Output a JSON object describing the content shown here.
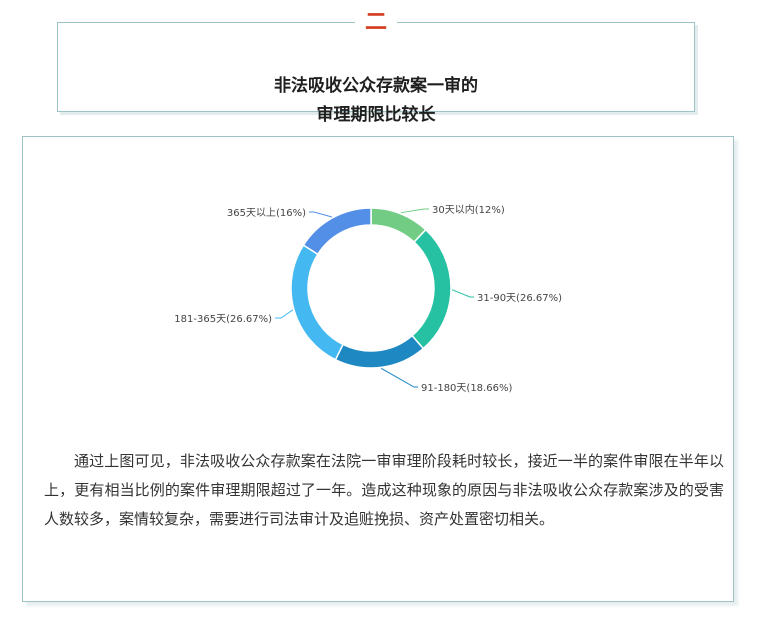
{
  "section": {
    "number": "二",
    "title_line1": "非法吸收公众存款案一审的",
    "title_line2": "审理期限比较长"
  },
  "chart_data": {
    "type": "pie",
    "donut": true,
    "categories": [
      "30天以内",
      "31-90天",
      "91-180天",
      "181-365天",
      "365天以上"
    ],
    "values": [
      12,
      26.67,
      18.66,
      26.67,
      16
    ],
    "labels": [
      "30天以内(12%)",
      "31-90天(26.67%)",
      "91-180天(18.66%)",
      "181-365天(26.67%)",
      "365天以上(16%)"
    ],
    "colors": [
      "#72cc83",
      "#25c1a2",
      "#1e88c3",
      "#44b8f1",
      "#538fe6"
    ],
    "title": ""
  },
  "paragraph": "通过上图可见，非法吸收公众存款案在法院一审审理阶段耗时较长，接近一半的案件审限在半年以上，更有相当比例的案件审理期限超过了一年。造成这种现象的原因与非法吸收公众存款案涉及的受害人数较多，案情较复杂，需要进行司法审计及追赃挽损、资产处置密切相关。"
}
